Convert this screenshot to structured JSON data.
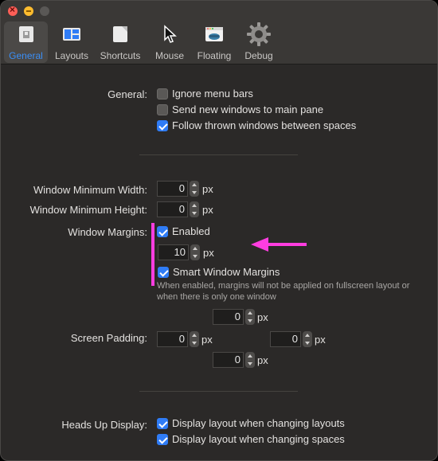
{
  "tabs": [
    {
      "label": "General",
      "icon": "general-prefs-icon",
      "active": true
    },
    {
      "label": "Layouts",
      "icon": "layouts-icon"
    },
    {
      "label": "Shortcuts",
      "icon": "shortcuts-icon"
    },
    {
      "label": "Mouse",
      "icon": "mouse-cursor-icon"
    },
    {
      "label": "Floating",
      "icon": "floating-window-icon"
    },
    {
      "label": "Debug",
      "icon": "gear-icon"
    }
  ],
  "general": {
    "label": "General:",
    "options": [
      {
        "label": "Ignore menu bars",
        "checked": false
      },
      {
        "label": "Send new windows to main pane",
        "checked": false
      },
      {
        "label": "Follow thrown windows between spaces",
        "checked": true
      }
    ]
  },
  "min_width": {
    "label": "Window Minimum Width:",
    "value": "0",
    "unit": "px"
  },
  "min_height": {
    "label": "Window Minimum Height:",
    "value": "0",
    "unit": "px"
  },
  "margins": {
    "label": "Window Margins:",
    "enabled_label": "Enabled",
    "enabled": true,
    "value": "10",
    "unit": "px",
    "smart_label": "Smart Window Margins",
    "smart_checked": true,
    "hint": "When enabled, margins will not be applied on fullscreen layout or when there is only one window"
  },
  "padding": {
    "label": "Screen Padding:",
    "top": "0",
    "left": "0",
    "right": "0",
    "bottom": "0",
    "unit": "px"
  },
  "hud": {
    "label": "Heads Up Display:",
    "options": [
      {
        "label": "Display layout when changing layouts",
        "checked": true
      },
      {
        "label": "Display layout when changing spaces",
        "checked": true
      }
    ]
  },
  "colors": {
    "accent": "#2f7cf6",
    "annotation": "#ff3de0"
  }
}
